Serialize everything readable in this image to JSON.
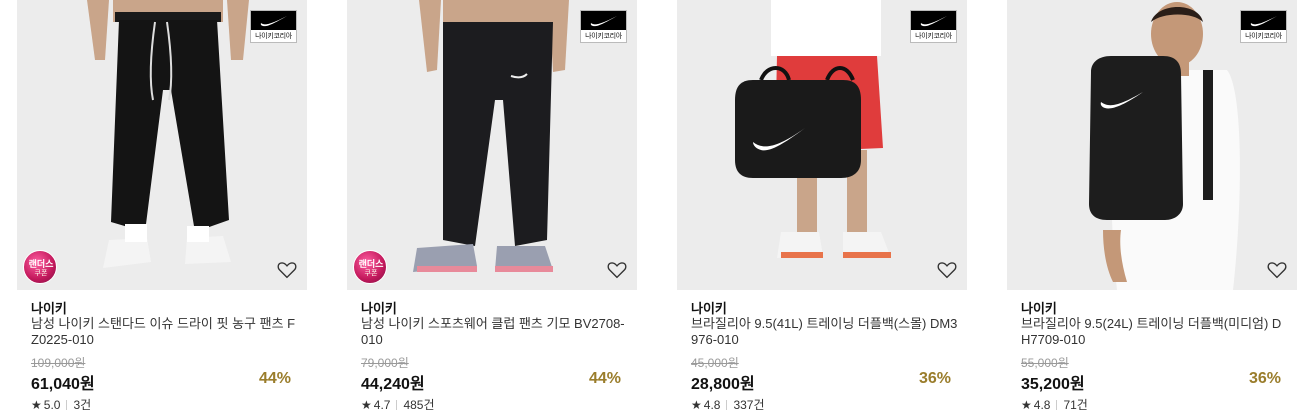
{
  "products": [
    {
      "badge_text": "나이키코리아",
      "coupon_line1": "랜더스",
      "coupon_line2": "쿠폰",
      "brand": "나이키",
      "title": "남성 나이키 스탠다드 이슈 드라이 핏 농구 팬츠 FZ0225-010",
      "original_price": "109,000원",
      "price": "61,040원",
      "discount": "44%",
      "star": "★",
      "rating": "5.0",
      "reviews": "3건",
      "image_icon": "black-jogger-pants"
    },
    {
      "badge_text": "나이키코리아",
      "coupon_line1": "랜더스",
      "coupon_line2": "쿠폰",
      "brand": "나이키",
      "title": "남성 나이키 스포츠웨어 클럽 팬츠 기모 BV2708-010",
      "original_price": "79,000원",
      "price": "44,240원",
      "discount": "44%",
      "star": "★",
      "rating": "4.7",
      "reviews": "485건",
      "image_icon": "black-fleece-pants"
    },
    {
      "badge_text": "나이키코리아",
      "brand": "나이키",
      "title": "브라질리아 9.5(41L) 트레이닝 더플백(스몰) DM3976-010",
      "original_price": "45,000원",
      "price": "28,800원",
      "discount": "36%",
      "star": "★",
      "rating": "4.8",
      "reviews": "337건",
      "image_icon": "black-duffel-bag"
    },
    {
      "badge_text": "나이키코리아",
      "brand": "나이키",
      "title": "브라질리아 9.5(24L) 트레이닝 더플백(미디엄) DH7709-010",
      "original_price": "55,000원",
      "price": "35,200원",
      "discount": "36%",
      "star": "★",
      "rating": "4.8",
      "reviews": "71건",
      "image_icon": "black-backpack"
    }
  ],
  "colors": {
    "discount": "#9a7d2b",
    "coupon": "#c2185b",
    "badge": "#000000"
  }
}
